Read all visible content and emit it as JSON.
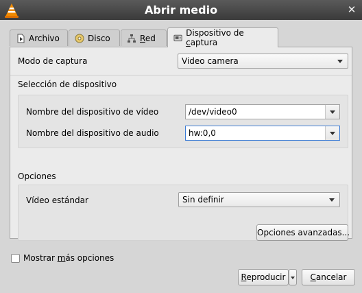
{
  "window": {
    "title": "Abrir medio"
  },
  "tabs": [
    {
      "label": "Archivo",
      "icon": "file-icon"
    },
    {
      "label": "Disco",
      "icon": "disc-icon"
    },
    {
      "label": "Red",
      "icon": "network-icon"
    },
    {
      "label": "Dispositivo de captura",
      "icon": "capture-device-icon",
      "active": true
    }
  ],
  "capture": {
    "mode_label": "Modo de captura",
    "mode_value": "Video camera",
    "device_section": "Selección de dispositivo",
    "video_label": "Nombre del dispositivo de vídeo",
    "video_value": "/dev/video0",
    "audio_label": "Nombre del dispositivo de audio",
    "audio_value": "hw:0,0",
    "options_section": "Opciones",
    "standard_label": "Vídeo estándar",
    "standard_value": "Sin definir",
    "advanced_button": "Opciones avanzadas..."
  },
  "footer": {
    "more_options": "Mostrar más opciones",
    "more_options_checked": false,
    "play_button": "Reproducir",
    "cancel_button": "Cancelar"
  }
}
